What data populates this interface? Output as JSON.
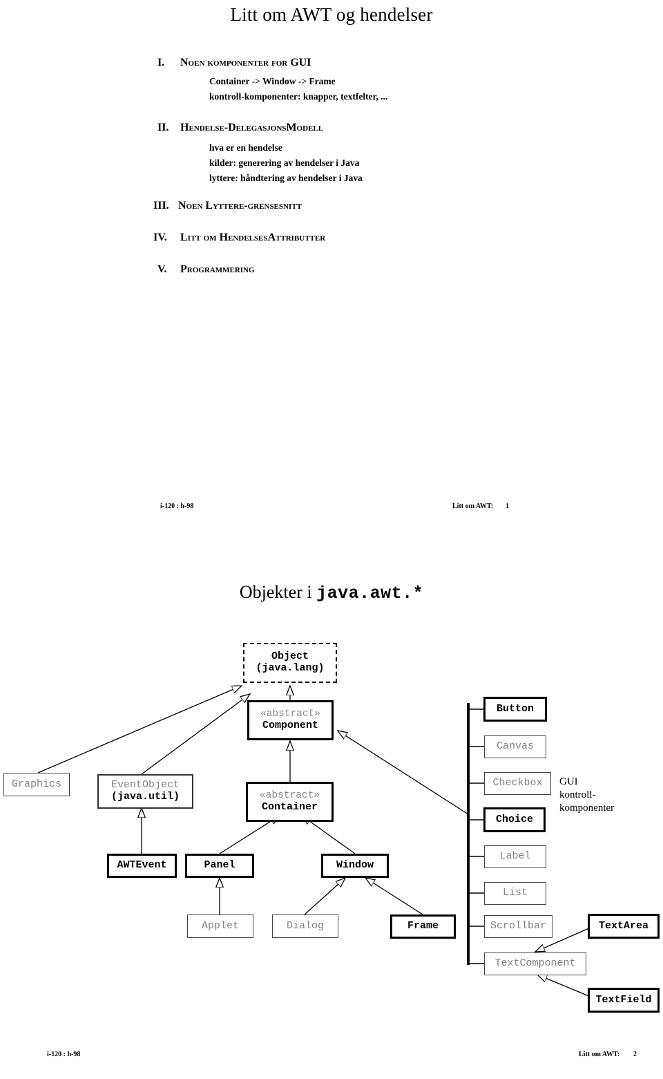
{
  "page1": {
    "title": "Litt om AWT og hendelser",
    "outline": [
      {
        "num": "I.",
        "heading_main": "N",
        "heading_rest": "OEN KOMPONENTER FOR ",
        "heading_tail_cap": "GUI",
        "heading_plain": "Noen komponenter for GUI",
        "subs": [
          "Container -> Window -> Frame",
          "kontroll-komponenter: knapper, textfelter, ..."
        ]
      },
      {
        "num": "II.",
        "heading_plain": "Hendelse-DelegasjonsModell",
        "subs": [
          "hva er en hendelse",
          "kilder: generering av hendelser i Java",
          "lyttere: håndtering av hendelser i Java"
        ]
      },
      {
        "num": "III.",
        "heading_plain": "Noen Lyttere-grensesnitt",
        "subs": []
      },
      {
        "num": "IV.",
        "heading_plain": "Litt om HendelsesAttributter",
        "subs": []
      },
      {
        "num": "V.",
        "heading_plain": "Programmering",
        "subs": []
      }
    ],
    "footer": {
      "left": "i-120 : h-98",
      "right": "Litt om AWT:",
      "pageno": "1"
    }
  },
  "page2": {
    "title_prefix": "Objekter i ",
    "title_mono": "java.awt.*",
    "annotation": {
      "line1": "GUI",
      "line2": "kontroll-",
      "line3": "komponenter"
    },
    "nodes": [
      {
        "id": "object",
        "name": "Object",
        "sub": "(java.lang)",
        "style": "dashed"
      },
      {
        "id": "component",
        "name": "Component",
        "stereotype": "«abstract»",
        "style": "bold"
      },
      {
        "id": "container",
        "name": "Container",
        "stereotype": "«abstract»",
        "style": "bold"
      },
      {
        "id": "graphics",
        "name": "Graphics",
        "style": "plain"
      },
      {
        "id": "eventobject",
        "name": "EventObject",
        "sub": "(java.util)",
        "style": "plain-sub-bold"
      },
      {
        "id": "awtevent",
        "name": "AWTEvent",
        "style": "bold"
      },
      {
        "id": "panel",
        "name": "Panel",
        "style": "bold"
      },
      {
        "id": "window",
        "name": "Window",
        "style": "bold"
      },
      {
        "id": "applet",
        "name": "Applet",
        "style": "plain"
      },
      {
        "id": "dialog",
        "name": "Dialog",
        "style": "plain"
      },
      {
        "id": "frame",
        "name": "Frame",
        "style": "bold"
      },
      {
        "id": "button",
        "name": "Button",
        "style": "bold"
      },
      {
        "id": "canvas",
        "name": "Canvas",
        "style": "plain"
      },
      {
        "id": "checkbox",
        "name": "Checkbox",
        "style": "plain"
      },
      {
        "id": "choice",
        "name": "Choice",
        "style": "bold"
      },
      {
        "id": "label",
        "name": "Label",
        "style": "plain"
      },
      {
        "id": "list",
        "name": "List",
        "style": "plain"
      },
      {
        "id": "scrollbar",
        "name": "Scrollbar",
        "style": "plain"
      },
      {
        "id": "textcomponent",
        "name": "TextComponent",
        "style": "plain"
      },
      {
        "id": "textarea",
        "name": "TextArea",
        "style": "bold"
      },
      {
        "id": "textfield",
        "name": "TextField",
        "style": "bold"
      }
    ],
    "footer": {
      "left": "i-120 : h-98",
      "right": "Litt om AWT:",
      "pageno": "2"
    }
  }
}
